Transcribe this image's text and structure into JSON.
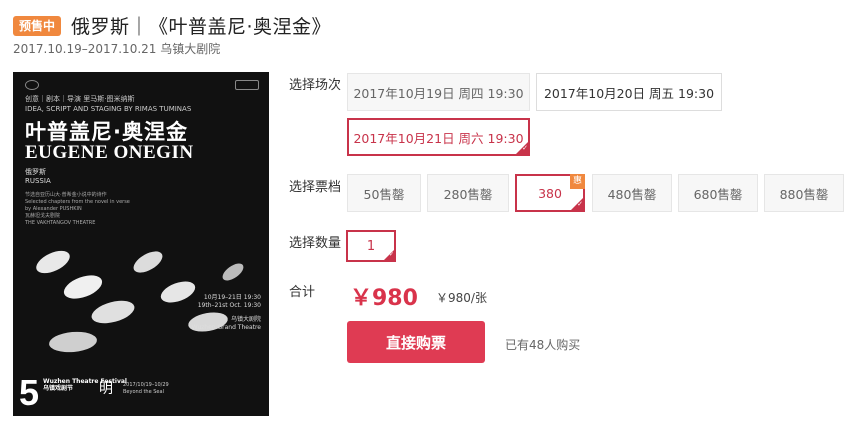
{
  "header": {
    "badge": "预售中",
    "title": "俄罗斯｜《叶普盖尼·奥涅金》",
    "subtitle": "2017.10.19–2017.10.21 乌镇大剧院"
  },
  "poster": {
    "top_text": "创意｜剧本｜导演 里马斯·图米纳斯",
    "top_text_en": "IDEA, SCRIPT AND STAGING BY RIMAS TUMINAS",
    "title_cn": "叶普盖尼·奥涅金",
    "title_en": "EUGENE ONEGIN",
    "country_cn": "俄罗斯",
    "country_en": "RUSSIA",
    "desc_cn": "节选自亚历山大·普希金小说中的诗作",
    "desc_en": "Selected chapters from the novel in verse by Alexander PUSHKIN",
    "theatre_cn": "瓦赫坦戈夫剧院",
    "theatre_en": "THE VAKHTANGOV THEATRE",
    "dates_cn": "10月19–21日 19:30",
    "dates_en": "19th–21st Oct. 19:30",
    "venue_cn": "乌镇大剧院",
    "venue_en": "Wuzhen Grand Theatre",
    "festival_num": "5",
    "festival_name": "Wuzhen Theatre Festival",
    "festival_cn": "乌镇戏剧节",
    "bottom_date": "2017/10/19–10/29",
    "bottom_text": "Beyond the Seal",
    "logo_mid": "明"
  },
  "session": {
    "label": "选择场次",
    "options": [
      "2017年10月19日 周四 19:30",
      "2017年10月20日 周五 19:30",
      "2017年10月21日 周六 19:30"
    ],
    "selected": 2
  },
  "tier": {
    "label": "选择票档",
    "options": [
      "50售罄",
      "280售罄",
      "380",
      "480售罄",
      "680售罄",
      "880售罄"
    ],
    "selected": 2,
    "selected_tag": "惠"
  },
  "quantity": {
    "label": "选择数量",
    "value": "1"
  },
  "total": {
    "label": "合计",
    "amount": "￥980",
    "unit_price": "￥980/张"
  },
  "buy": {
    "button": "直接购票",
    "bought": "已有48人购买"
  },
  "colors": {
    "accent": "#df3b53",
    "badge": "#f0883e"
  }
}
